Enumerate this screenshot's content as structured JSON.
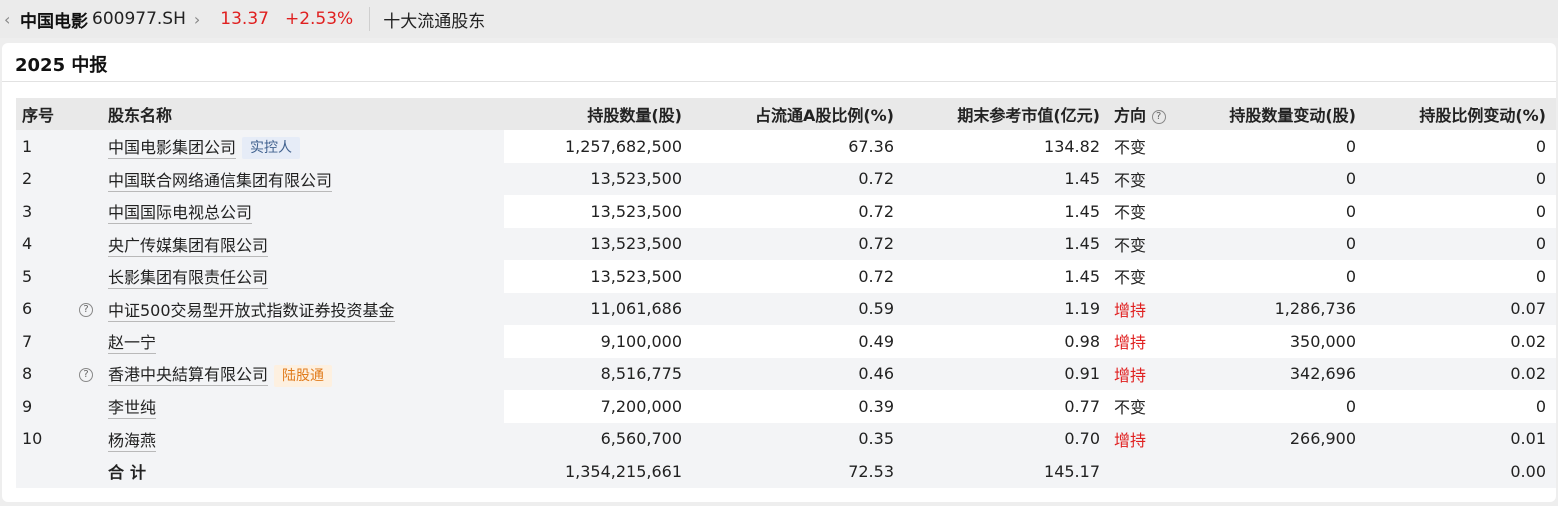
{
  "header": {
    "stock_name": "中国电影",
    "stock_code": "600977.SH",
    "price": "13.37",
    "change_pct": "+2.53%",
    "section": "十大流通股东"
  },
  "panel": {
    "title": "2025 中报"
  },
  "table": {
    "columns": [
      "序号",
      "股东名称",
      "持股数量(股)",
      "占流通A股比例(%)",
      "期末参考市值(亿元)",
      "方向",
      "持股数量变动(股)",
      "持股比例变动(%)"
    ],
    "rows": [
      {
        "idx": "1",
        "name": "中国电影集团公司",
        "help": false,
        "tag": "实控人",
        "tag_style": "blue",
        "shares": "1,257,682,500",
        "ratio": "67.36",
        "value": "134.82",
        "direction": "不变",
        "shares_change": "0",
        "ratio_change": "0"
      },
      {
        "idx": "2",
        "name": "中国联合网络通信集团有限公司",
        "help": false,
        "tag": "",
        "tag_style": "",
        "shares": "13,523,500",
        "ratio": "0.72",
        "value": "1.45",
        "direction": "不变",
        "shares_change": "0",
        "ratio_change": "0"
      },
      {
        "idx": "3",
        "name": "中国国际电视总公司",
        "help": false,
        "tag": "",
        "tag_style": "",
        "shares": "13,523,500",
        "ratio": "0.72",
        "value": "1.45",
        "direction": "不变",
        "shares_change": "0",
        "ratio_change": "0"
      },
      {
        "idx": "4",
        "name": "央广传媒集团有限公司",
        "help": false,
        "tag": "",
        "tag_style": "",
        "shares": "13,523,500",
        "ratio": "0.72",
        "value": "1.45",
        "direction": "不变",
        "shares_change": "0",
        "ratio_change": "0"
      },
      {
        "idx": "5",
        "name": "长影集团有限责任公司",
        "help": false,
        "tag": "",
        "tag_style": "",
        "shares": "13,523,500",
        "ratio": "0.72",
        "value": "1.45",
        "direction": "不变",
        "shares_change": "0",
        "ratio_change": "0"
      },
      {
        "idx": "6",
        "name": "中证500交易型开放式指数证券投资基金",
        "help": true,
        "tag": "",
        "tag_style": "",
        "shares": "11,061,686",
        "ratio": "0.59",
        "value": "1.19",
        "direction": "增持",
        "shares_change": "1,286,736",
        "ratio_change": "0.07"
      },
      {
        "idx": "7",
        "name": "赵一宁",
        "help": false,
        "tag": "",
        "tag_style": "",
        "shares": "9,100,000",
        "ratio": "0.49",
        "value": "0.98",
        "direction": "增持",
        "shares_change": "350,000",
        "ratio_change": "0.02"
      },
      {
        "idx": "8",
        "name": "香港中央結算有限公司",
        "help": true,
        "tag": "陆股通",
        "tag_style": "orange",
        "shares": "8,516,775",
        "ratio": "0.46",
        "value": "0.91",
        "direction": "增持",
        "shares_change": "342,696",
        "ratio_change": "0.02"
      },
      {
        "idx": "9",
        "name": "李世纯",
        "help": false,
        "tag": "",
        "tag_style": "",
        "shares": "7,200,000",
        "ratio": "0.39",
        "value": "0.77",
        "direction": "不变",
        "shares_change": "0",
        "ratio_change": "0"
      },
      {
        "idx": "10",
        "name": "杨海燕",
        "help": false,
        "tag": "",
        "tag_style": "",
        "shares": "6,560,700",
        "ratio": "0.35",
        "value": "0.70",
        "direction": "增持",
        "shares_change": "266,900",
        "ratio_change": "0.01"
      }
    ],
    "total": {
      "label": "合计",
      "shares": "1,354,215,661",
      "ratio": "72.53",
      "value": "145.17",
      "ratio_change": "0.00"
    }
  },
  "colors": {
    "up": "#e02020",
    "tag_blue_text": "#41628f",
    "tag_orange_text": "#e17c1d"
  }
}
